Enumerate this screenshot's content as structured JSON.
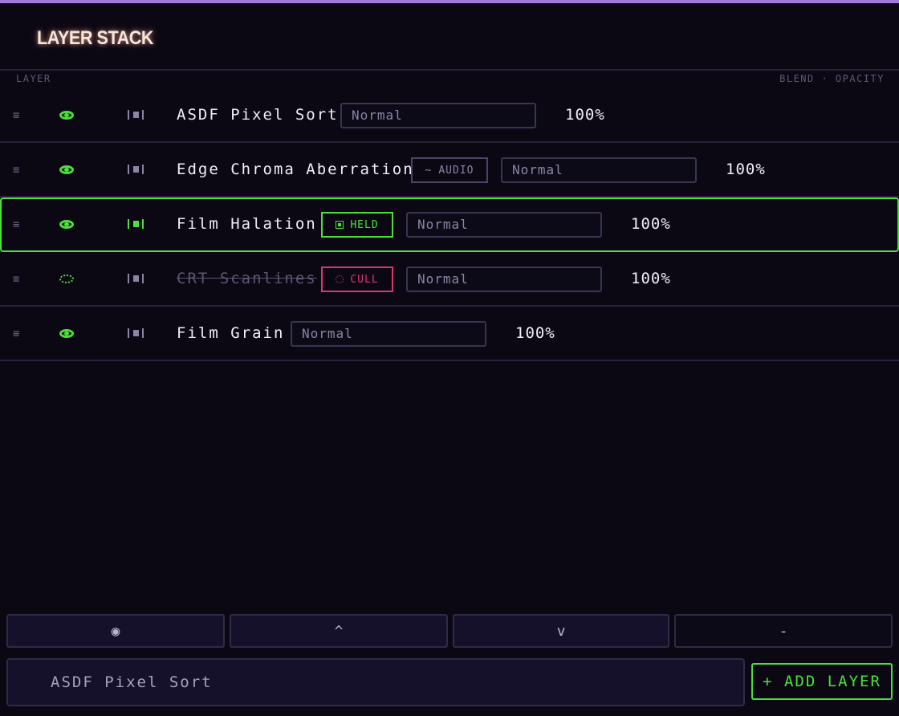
{
  "header": {
    "title": "LAYER STACK",
    "col_left": "LAYER",
    "col_right": "BLEND · OPACITY"
  },
  "colors": {
    "accent_green": "#48e23a",
    "cull_pink": "#e0336d",
    "top_bar": "#a07ad8",
    "background": "#0b0814"
  },
  "layers": [
    {
      "name": "ASDF Pixel Sort",
      "badge": "",
      "blend": "Normal",
      "opacity": "100%",
      "visible": true,
      "selected": false,
      "culled": false
    },
    {
      "name": "Edge Chroma Aberration",
      "badge": "AUDIO",
      "badge_icon": "~",
      "blend": "Normal",
      "opacity": "100%",
      "visible": true,
      "selected": false,
      "culled": false
    },
    {
      "name": "Film Halation",
      "badge": "HELD",
      "blend": "Normal",
      "opacity": "100%",
      "visible": true,
      "selected": true,
      "culled": false
    },
    {
      "name": "CRT Scanlines",
      "badge": "CULL",
      "blend": "Normal",
      "opacity": "100%",
      "visible": false,
      "selected": false,
      "culled": true
    },
    {
      "name": "Film Grain",
      "badge": "",
      "blend": "Normal",
      "opacity": "100%",
      "visible": true,
      "selected": false,
      "culled": false
    }
  ],
  "row_glyphs": {
    "handle": "≡"
  },
  "toolbar": {
    "visibility": "◉",
    "up": "^",
    "down": "v",
    "remove": "-"
  },
  "footer": {
    "new_layer_value": "ASDF Pixel Sort",
    "add_label": "+ ADD LAYER"
  }
}
